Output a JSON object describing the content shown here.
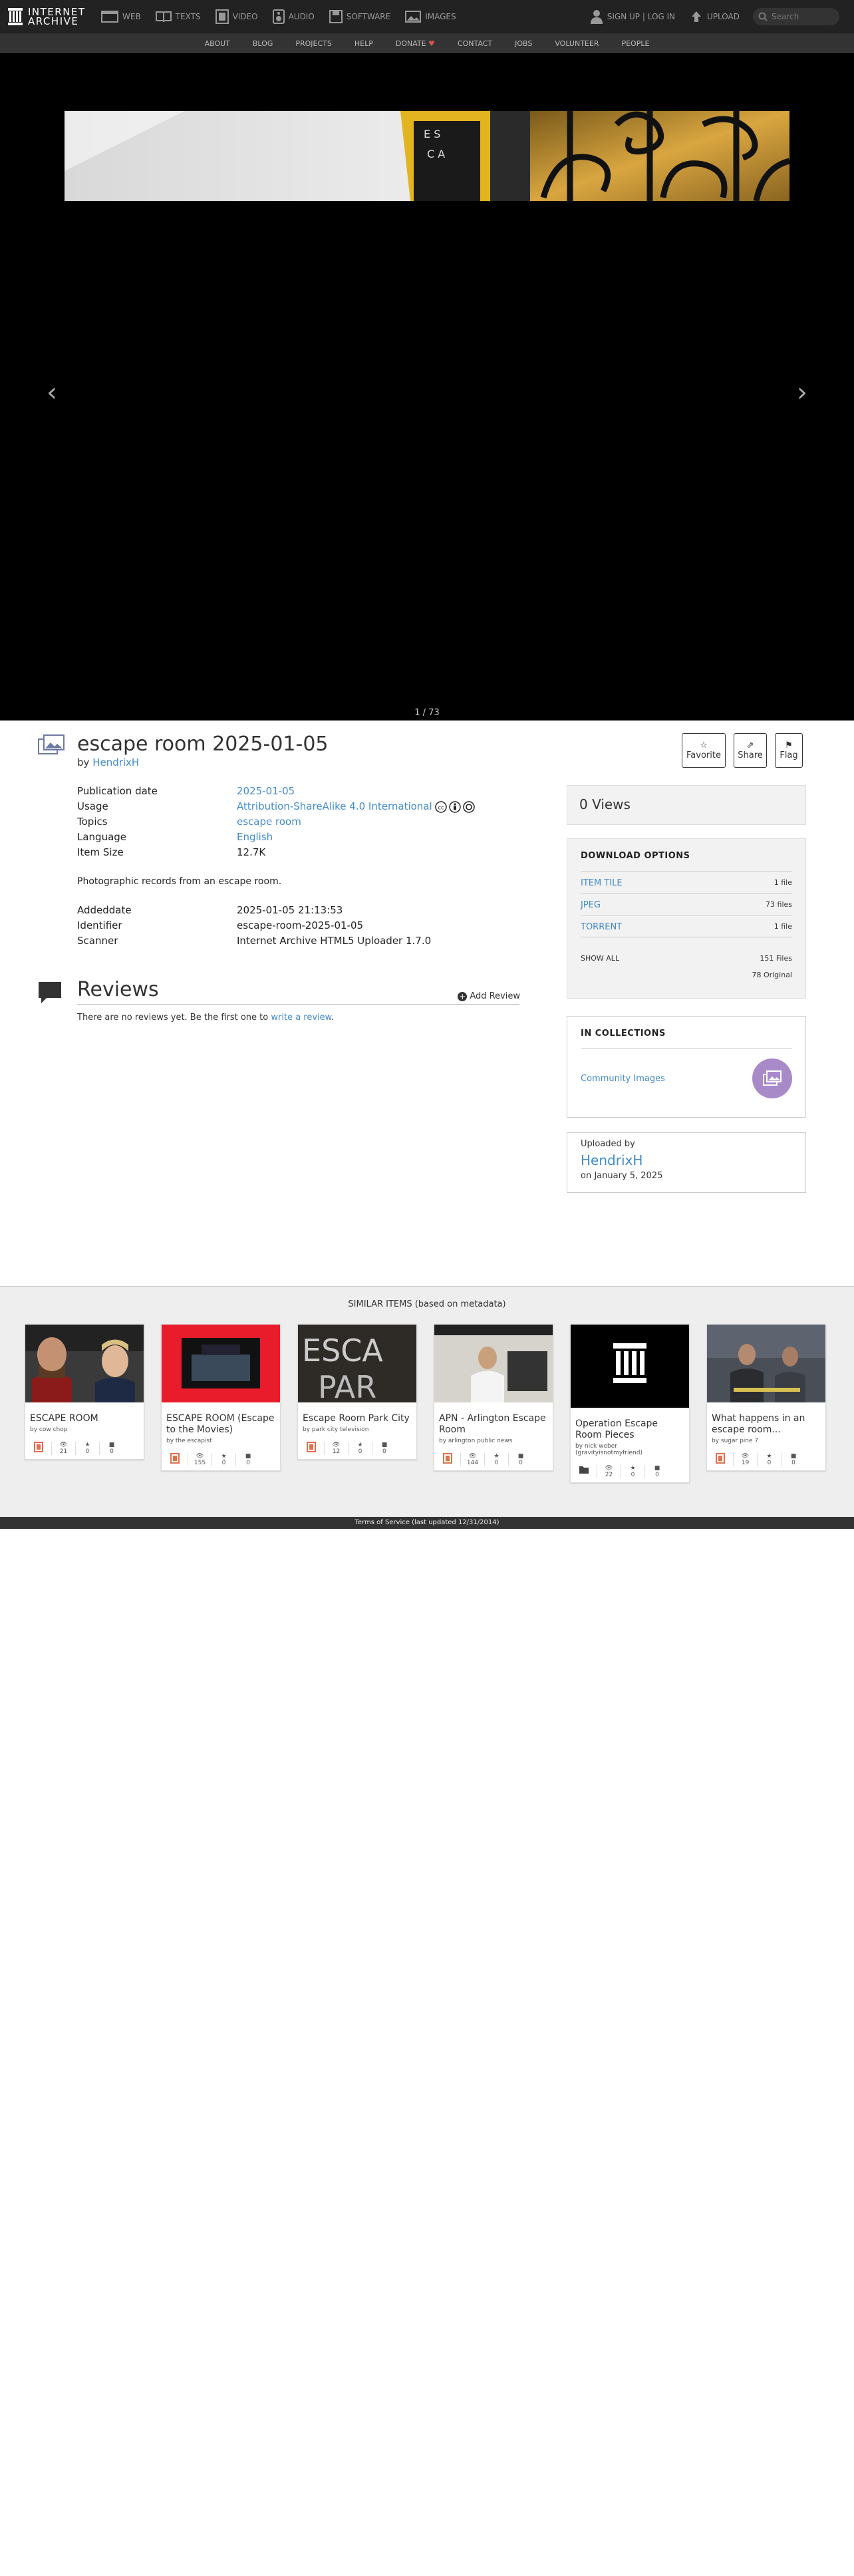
{
  "nav": {
    "logo_line1": "INTERNET",
    "logo_line2": "ARCHIVE",
    "items": [
      {
        "label": "WEB"
      },
      {
        "label": "TEXTS"
      },
      {
        "label": "VIDEO"
      },
      {
        "label": "AUDIO"
      },
      {
        "label": "SOFTWARE"
      },
      {
        "label": "IMAGES"
      }
    ],
    "signup": "SIGN UP | LOG IN",
    "upload": "UPLOAD",
    "search_placeholder": "Search"
  },
  "subnav": [
    "ABOUT",
    "BLOG",
    "PROJECTS",
    "HELP",
    "DONATE",
    "CONTACT",
    "JOBS",
    "VOLUNTEER",
    "PEOPLE"
  ],
  "viewer": {
    "counter": "1 / 73"
  },
  "item": {
    "title": "escape room 2025-01-05",
    "by_label": "by",
    "author": "HendrixH",
    "favorite": "Favorite",
    "share": "Share",
    "flag": "Flag"
  },
  "metadata": {
    "rows": [
      {
        "key": "Publication date",
        "value": "2025-01-05"
      },
      {
        "key": "Usage",
        "value": "Attribution-ShareAlike 4.0 International"
      },
      {
        "key": "Topics",
        "value": "escape room"
      },
      {
        "key": "Language",
        "value": "English"
      },
      {
        "key": "Item Size",
        "value": "12.7K"
      }
    ],
    "description": "Photographic records from an escape room.",
    "rows2": [
      {
        "key": "Addeddate",
        "value": "2025-01-05 21:13:53"
      },
      {
        "key": "Identifier",
        "value": "escape-room-2025-01-05"
      },
      {
        "key": "Scanner",
        "value": "Internet Archive HTML5 Uploader 1.7.0"
      }
    ]
  },
  "reviews": {
    "title": "Reviews",
    "add": "Add Review",
    "none_text": "There are no reviews yet. Be the first one to",
    "write_link": "write a review",
    "period": "."
  },
  "sidebar": {
    "views": "0 Views",
    "download_header": "DOWNLOAD OPTIONS",
    "downloads": [
      {
        "label": "ITEM TILE",
        "count": "1 file"
      },
      {
        "label": "JPEG",
        "count": "73 files"
      },
      {
        "label": "TORRENT",
        "count": "1 file"
      }
    ],
    "show_all": "SHOW ALL",
    "total_files": "151 Files",
    "original": "78 Original",
    "collections_header": "IN COLLECTIONS",
    "collection": "Community Images",
    "uploaded_by_label": "Uploaded by",
    "uploader": "HendrixH",
    "uploaded_on": "on January 5, 2025"
  },
  "similar": {
    "header": "SIMILAR ITEMS (based on metadata)",
    "cards": [
      {
        "title": "ESCAPE ROOM",
        "by": "by cow chop",
        "views": "21",
        "favs": "0",
        "reviews": "0",
        "type": "film"
      },
      {
        "title": "ESCAPE ROOM (Escape to the Movies)",
        "by": "by the escapist",
        "views": "155",
        "favs": "0",
        "reviews": "0",
        "type": "film"
      },
      {
        "title": "Escape Room Park City",
        "by": "by park city television",
        "views": "12",
        "favs": "0",
        "reviews": "0",
        "type": "film"
      },
      {
        "title": "APN - Arlington Escape Room",
        "by": "by arlington public news",
        "views": "144",
        "favs": "0",
        "reviews": "0",
        "type": "film"
      },
      {
        "title": "Operation Escape Room Pieces",
        "by": "by nick weber (gravityisnotmyfriend)",
        "views": "22",
        "favs": "0",
        "reviews": "0",
        "type": "collection"
      },
      {
        "title": "What happens in an escape room...",
        "by": "by sugar pine 7",
        "views": "19",
        "favs": "0",
        "reviews": "0",
        "type": "film"
      }
    ]
  },
  "footer": "Terms of Service (last updated 12/31/2014)"
}
